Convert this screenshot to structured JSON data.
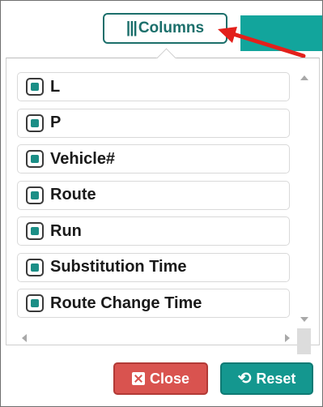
{
  "toolbar": {
    "columns_bars": "|||",
    "columns_label": "Columns",
    "accent_color": "#12a59c",
    "button_border_color": "#1c6f6b"
  },
  "columns_panel": {
    "items": [
      {
        "label": "L",
        "checked": true
      },
      {
        "label": "P",
        "checked": true
      },
      {
        "label": "Vehicle#",
        "checked": true
      },
      {
        "label": "Route",
        "checked": true
      },
      {
        "label": "Run",
        "checked": true
      },
      {
        "label": "Substitution Time",
        "checked": true
      },
      {
        "label": "Route Change Time",
        "checked": true
      }
    ],
    "checkbox_fill_color": "#1b8e86"
  },
  "footer": {
    "close_label": "Close",
    "reset_label": "Reset",
    "close_color": "#d9534f",
    "reset_color": "#14978f",
    "reset_icon_glyph": "⟲",
    "close_icon": "close-square-icon",
    "reset_icon": "undo-icon"
  },
  "annotation": {
    "arrow_color": "#e3201b"
  }
}
